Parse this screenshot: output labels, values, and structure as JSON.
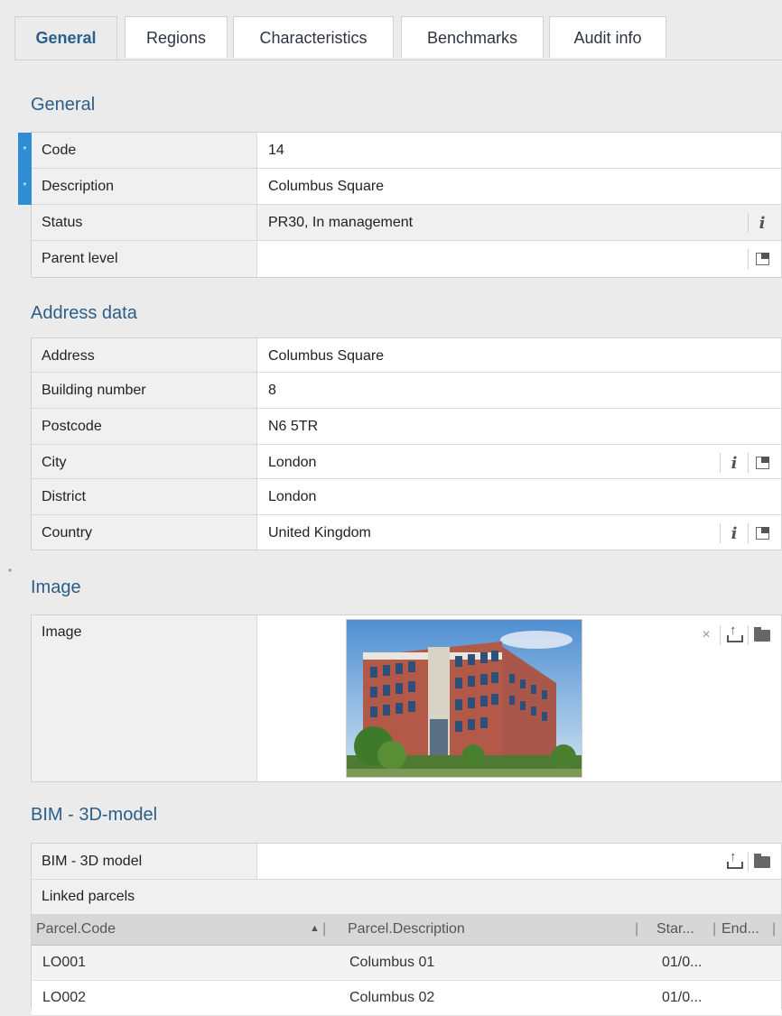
{
  "tabs": [
    {
      "label": "General"
    },
    {
      "label": "Regions"
    },
    {
      "label": "Characteristics"
    },
    {
      "label": "Benchmarks"
    },
    {
      "label": "Audit info"
    }
  ],
  "general": {
    "title": "General",
    "code_label": "Code",
    "code_value": "14",
    "description_label": "Description",
    "description_value": "Columbus Square",
    "status_label": "Status",
    "status_value": "PR30, In management",
    "parent_label": "Parent level",
    "parent_value": ""
  },
  "address": {
    "title": "Address data",
    "address_label": "Address",
    "address_value": "Columbus Square",
    "building_label": "Building number",
    "building_value": "8",
    "postcode_label": "Postcode",
    "postcode_value": "N6 5TR",
    "city_label": "City",
    "city_value": "London",
    "district_label": "District",
    "district_value": "London",
    "country_label": "Country",
    "country_value": "United Kingdom"
  },
  "image": {
    "title": "Image",
    "label": "Image",
    "clear_symbol": "×"
  },
  "bim": {
    "title": "BIM - 3D-model",
    "model_label": "BIM - 3D model",
    "linked_label": "Linked parcels",
    "columns": [
      "Parcel.Code",
      "Parcel.Description",
      "Star...",
      "End..."
    ],
    "rows": [
      {
        "code": "LO001",
        "description": "Columbus 01",
        "start": "01/0..."
      },
      {
        "code": "LO002",
        "description": "Columbus 02",
        "start": "01/0..."
      }
    ]
  },
  "colors": {
    "accent": "#2a5f8a",
    "required": "#2f8ed3"
  }
}
